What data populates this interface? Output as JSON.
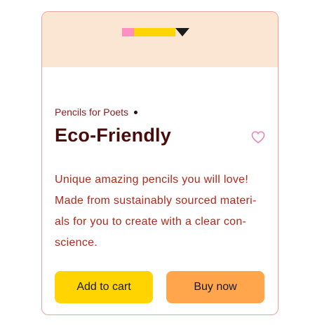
{
  "card": {
    "brand": "Pencils for Poets",
    "title": "Eco-Friendly",
    "description_lines": [
      "Unique amazing pencils you will love!",
      "Made from sustainably sourced materi-",
      "als for you to create with a clear con-",
      "science."
    ],
    "add_to_cart_label": "Add to cart",
    "buy_now_label": "Buy now",
    "icons": {
      "favorite": "heart-icon",
      "illustration": "pencil-icon",
      "separator": "dot"
    }
  },
  "colors": {
    "header_bg": "#fbe6d4",
    "card_border": "#f2a1a1",
    "title": "#4a0b0b",
    "brand_text": "#8a1c1c",
    "description_text": "#b02a1a",
    "heart": "#e889b5",
    "pencil_eraser": "#ff8fc3",
    "pencil_body": "#ffd400",
    "pencil_tip": "#1b1b1b",
    "cart_button": "#ffd400",
    "buy_button": "#ffa64d"
  }
}
